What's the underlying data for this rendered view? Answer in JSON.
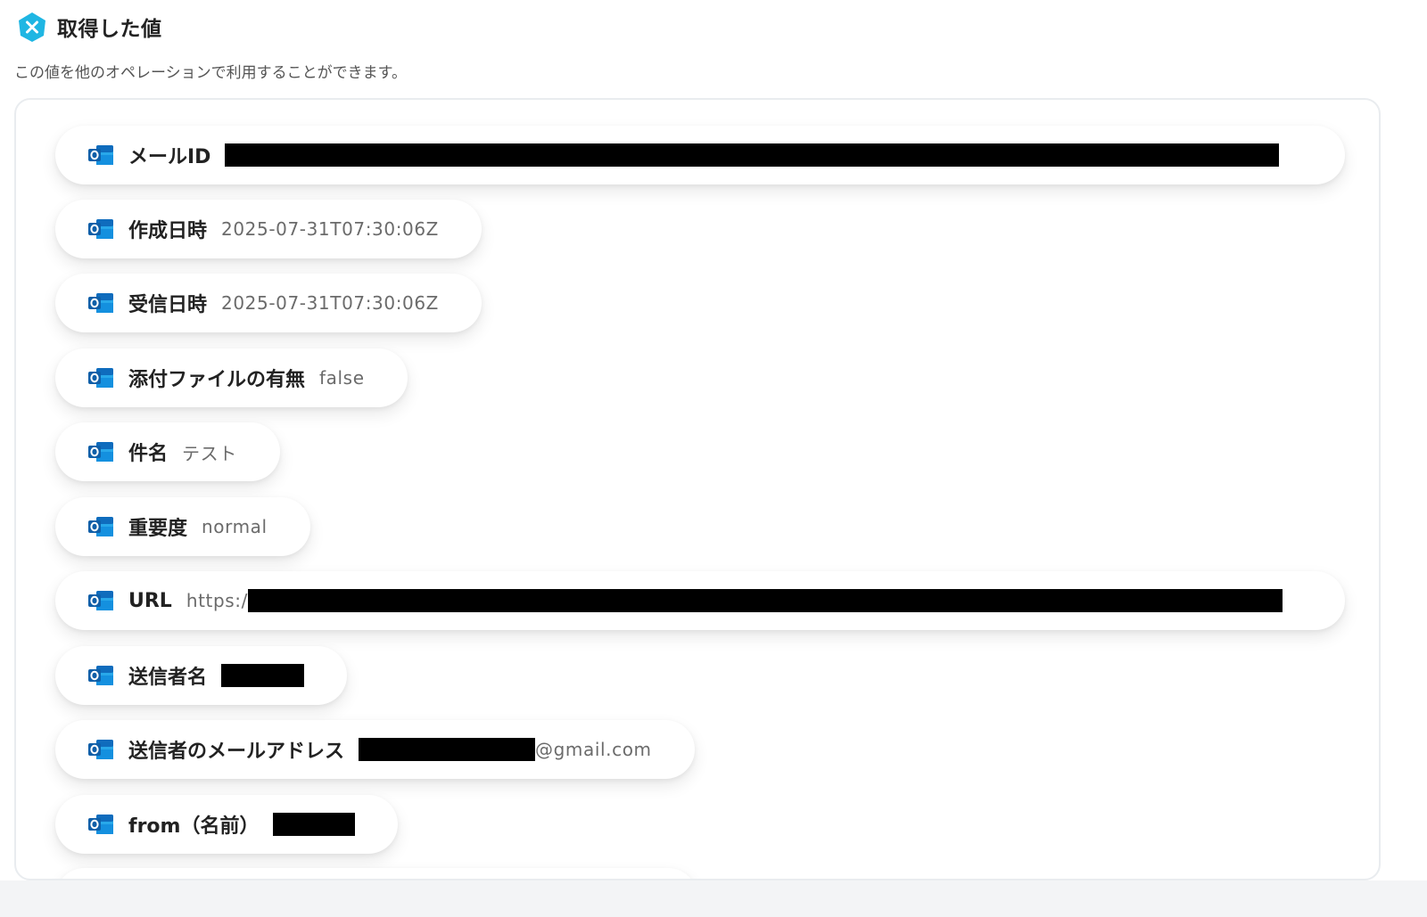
{
  "header": {
    "title": "取得した値",
    "badge_color": "#1fb6e3",
    "badge_icon": "x-icon"
  },
  "description": "この値を他のオペレーションで利用することができます。",
  "items": [
    {
      "label": "メールID",
      "value": "",
      "icon": "outlook-icon",
      "redacted": true
    },
    {
      "label": "作成日時",
      "value": "2025-07-31T07:30:06Z",
      "icon": "outlook-icon"
    },
    {
      "label": "受信日時",
      "value": "2025-07-31T07:30:06Z",
      "icon": "outlook-icon"
    },
    {
      "label": "添付ファイルの有無",
      "value": "false",
      "icon": "outlook-icon"
    },
    {
      "label": "件名",
      "value": "テスト",
      "icon": "outlook-icon"
    },
    {
      "label": "重要度",
      "value": "normal",
      "icon": "outlook-icon"
    },
    {
      "label": "URL",
      "value": "https:/",
      "icon": "outlook-icon",
      "redacted": true
    },
    {
      "label": "送信者名",
      "value": "",
      "icon": "outlook-icon",
      "redacted": true
    },
    {
      "label": "送信者のメールアドレス",
      "value": "@gmail.com",
      "icon": "outlook-icon",
      "redacted": true
    },
    {
      "label": "from（名前）",
      "value": "",
      "icon": "outlook-icon",
      "redacted": true
    }
  ],
  "colors": {
    "outlook_blue": "#0f6cbd",
    "outlook_light": "#28a8ea",
    "accent": "#1fb6e3"
  }
}
